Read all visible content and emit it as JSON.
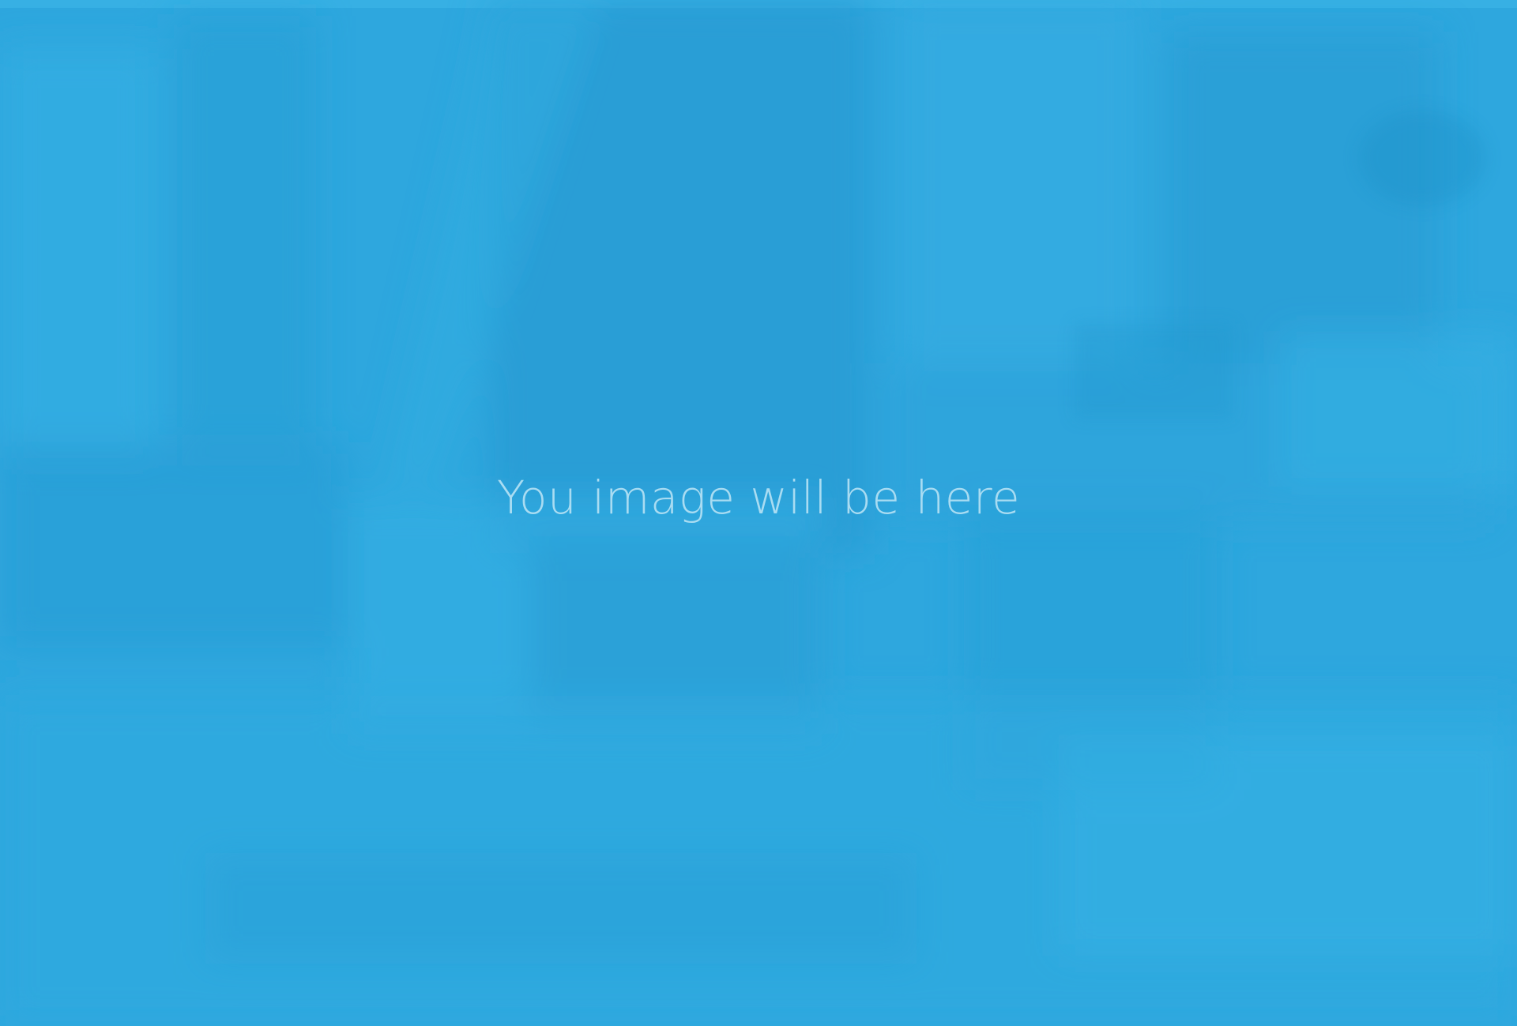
{
  "placeholder": {
    "text": "You image will be here"
  },
  "colors": {
    "background": "#2ea7de",
    "text": "#a9dcf2"
  }
}
